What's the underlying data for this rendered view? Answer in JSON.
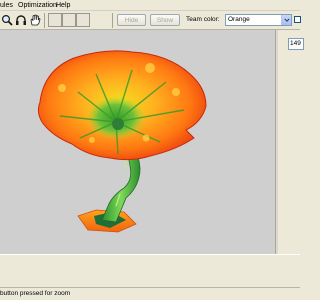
{
  "menubar": {
    "items": [
      "ules",
      "Optimization",
      "Help"
    ]
  },
  "toolbar": {
    "tools": [
      {
        "icon": "magnifier-icon"
      },
      {
        "icon": "headphones-icon"
      },
      {
        "icon": "hand-icon"
      }
    ],
    "hide_label": "Hide",
    "show_label": "Show",
    "team_color_label": "Team color:",
    "team_color_value": "Orange"
  },
  "side_panel": {
    "value": "149"
  },
  "status": {
    "text": "button pressed for zoom"
  },
  "colors": {
    "viewport_bg": "#cfcfcf",
    "chrome": "#ece9d8"
  }
}
